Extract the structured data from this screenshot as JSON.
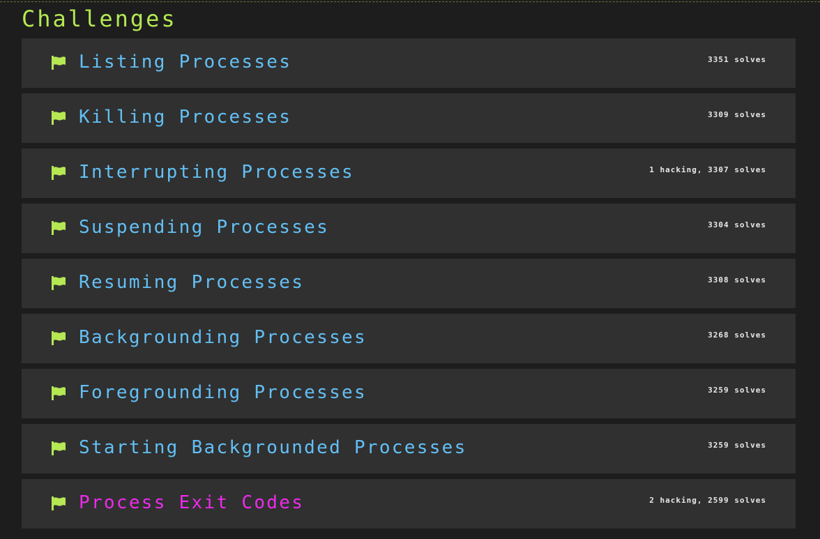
{
  "section": {
    "title": "Challenges"
  },
  "colors": {
    "title": "#b5e853",
    "flag": "#b5e853",
    "challenge_name": "#63c0f5",
    "active_challenge_name": "#ed2aec",
    "card_background": "#303030",
    "page_background": "#1d1d1d"
  },
  "icons": {
    "flag": "flag-icon"
  },
  "challenges": [
    {
      "name": "Listing Processes",
      "status": "3351 solves"
    },
    {
      "name": "Killing Processes",
      "status": "3309 solves"
    },
    {
      "name": "Interrupting Processes",
      "status": "1 hacking, 3307 solves"
    },
    {
      "name": "Suspending Processes",
      "status": "3304 solves"
    },
    {
      "name": "Resuming Processes",
      "status": "3308 solves"
    },
    {
      "name": "Backgrounding Processes",
      "status": "3268 solves"
    },
    {
      "name": "Foregrounding Processes",
      "status": "3259 solves"
    },
    {
      "name": "Starting Backgrounded Processes",
      "status": "3259 solves"
    },
    {
      "name": "Process Exit Codes",
      "status": "2 hacking, 2599 solves"
    }
  ]
}
